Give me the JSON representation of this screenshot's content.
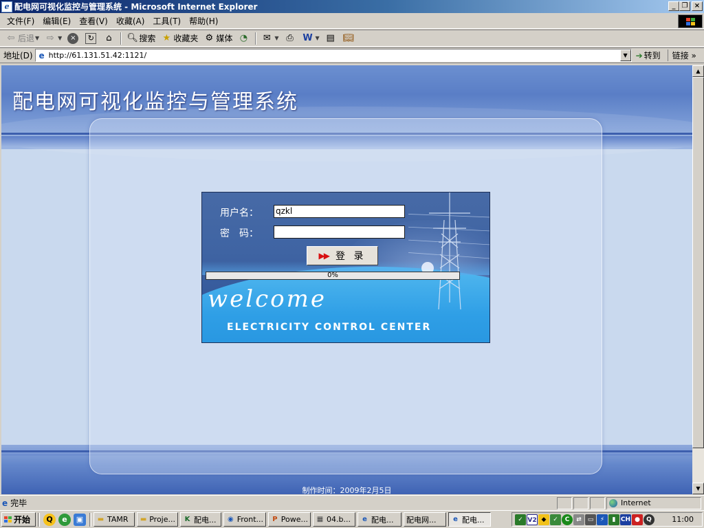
{
  "window": {
    "title": "配电网可视化监控与管理系统 - Microsoft Internet Explorer",
    "minimize_glyph": "_",
    "maximize_glyph": "❐",
    "close_glyph": "×"
  },
  "menu": {
    "items": [
      {
        "label": "文件(F)"
      },
      {
        "label": "编辑(E)"
      },
      {
        "label": "查看(V)"
      },
      {
        "label": "收藏(A)"
      },
      {
        "label": "工具(T)"
      },
      {
        "label": "帮助(H)"
      }
    ]
  },
  "toolbar": {
    "back_label": "后退",
    "search_label": "搜索",
    "favorites_label": "收藏夹",
    "media_label": "媒体"
  },
  "address": {
    "label": "地址(D)",
    "url": "http://61.131.51.42:1121/",
    "go_label": "转到",
    "links_label": "链接"
  },
  "page": {
    "title": "配电网可视化监控与管理系统",
    "footer_credit": "制作时间：2009年2月5日",
    "login": {
      "username_label": "用户名：",
      "password_label": "密　码：",
      "username_value": "qzkl",
      "password_value": "",
      "login_button_label": "登 录",
      "progress_text": "0%",
      "progress_value": 0,
      "welcome_text": "welcome",
      "subtitle": "ELECTRICITY CONTROL CENTER"
    }
  },
  "status": {
    "text": "完毕",
    "zone": "Internet"
  },
  "taskbar": {
    "start_label": "开始",
    "tasks": [
      {
        "label": "TAMR",
        "icon": "folder-icon",
        "active": false
      },
      {
        "label": "Proje...",
        "icon": "folder-icon",
        "active": false
      },
      {
        "label": "配电...",
        "icon": "app-icon",
        "active": false
      },
      {
        "label": "Front...",
        "icon": "frontpage-icon",
        "active": false
      },
      {
        "label": "Powe...",
        "icon": "powerpoint-icon",
        "active": false
      },
      {
        "label": "04.b...",
        "icon": "image-icon",
        "active": false
      },
      {
        "label": "配电...",
        "icon": "ie-icon",
        "active": false
      },
      {
        "label": "配电网...",
        "icon": "none",
        "active": false
      },
      {
        "label": "配电...",
        "icon": "ie-icon",
        "active": true
      }
    ],
    "tray_badges": [
      "V2",
      "CH"
    ],
    "clock": "11:00"
  }
}
